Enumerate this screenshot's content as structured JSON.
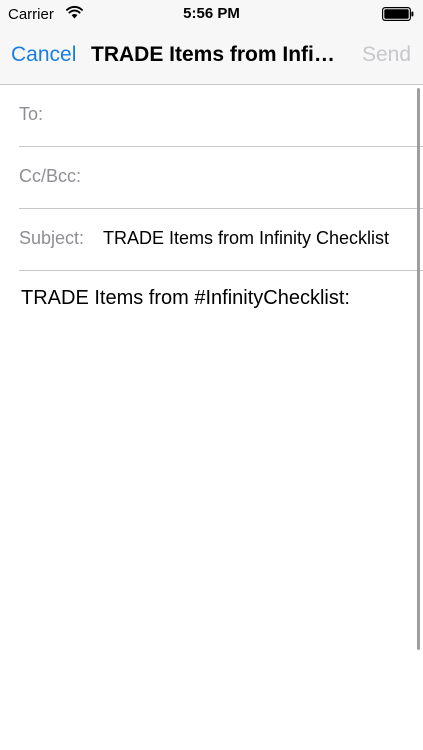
{
  "status_bar": {
    "carrier": "Carrier",
    "time": "5:56 PM",
    "wifi_icon": "wifi-icon",
    "battery_icon": "battery-full-icon"
  },
  "nav": {
    "cancel_label": "Cancel",
    "title": "TRADE Items from Infinity Checklist",
    "send_label": "Send"
  },
  "fields": {
    "to_label": "To:",
    "to_value": "",
    "cc_label": "Cc/Bcc:",
    "cc_value": "",
    "subject_label": "Subject:",
    "subject_value": "TRADE Items from Infinity Checklist"
  },
  "body": {
    "text": "TRADE Items from #InfinityChecklist:"
  },
  "colors": {
    "accent": "#1a7ee1",
    "disabled": "#c7c7cc",
    "label_gray": "#8e8e93",
    "separator": "#c8c7cc",
    "bar_background": "#f7f7f7"
  }
}
